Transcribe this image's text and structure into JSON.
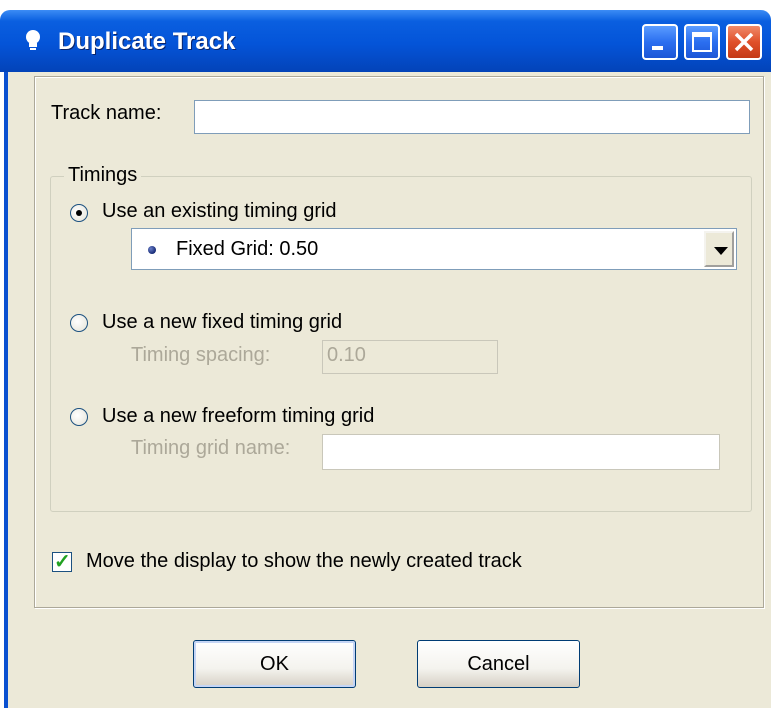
{
  "window": {
    "title": "Duplicate Track",
    "icon": "lightbulb-icon",
    "minimize_icon": "minimize-icon",
    "maximize_icon": "maximize-icon",
    "close_icon": "close-icon"
  },
  "track_name": {
    "label": "Track name:",
    "value": ""
  },
  "timings": {
    "group_label": "Timings",
    "existing": {
      "label": "Use an existing timing grid",
      "selected": true,
      "dropdown_value": "Fixed Grid: 0.50"
    },
    "fixed": {
      "label": "Use a new fixed timing grid",
      "selected": false,
      "spacing_label": "Timing spacing:",
      "spacing_value": "0.10"
    },
    "freeform": {
      "label": "Use a new freeform timing grid",
      "selected": false,
      "name_label": "Timing grid name:",
      "name_value": ""
    }
  },
  "move_display": {
    "label": "Move the display to show the newly created track",
    "checked": true
  },
  "buttons": {
    "ok": "OK",
    "cancel": "Cancel"
  },
  "colors": {
    "titlebar": "#0454d8",
    "dialog_bg": "#ece9d8",
    "disabled_text": "#aca899"
  }
}
